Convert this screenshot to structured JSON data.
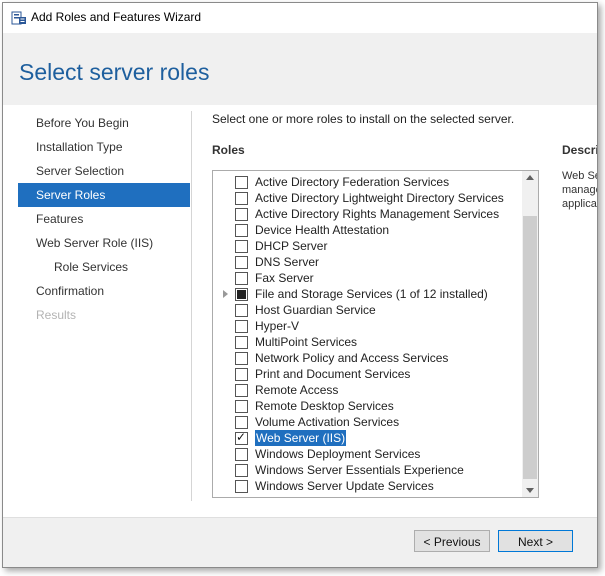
{
  "window": {
    "title": "Add Roles and Features Wizard"
  },
  "header": {
    "title": "Select server roles"
  },
  "nav": {
    "items": [
      {
        "label": "Before You Begin",
        "state": "normal"
      },
      {
        "label": "Installation Type",
        "state": "normal"
      },
      {
        "label": "Server Selection",
        "state": "normal"
      },
      {
        "label": "Server Roles",
        "state": "selected"
      },
      {
        "label": "Features",
        "state": "normal"
      },
      {
        "label": "Web Server Role (IIS)",
        "state": "normal"
      },
      {
        "label": "Role Services",
        "state": "indent"
      },
      {
        "label": "Confirmation",
        "state": "normal"
      },
      {
        "label": "Results",
        "state": "disabled"
      }
    ]
  },
  "main": {
    "instructions": "Select one or more roles to install on the selected server.",
    "roles_label": "Roles",
    "description_label": "Description",
    "description_lines": [
      "Web Server (IIS) provides a reliable,",
      "manageable, and scalable Web",
      "application infrastructure."
    ]
  },
  "roles": [
    {
      "label": "Active Directory Federation Services",
      "checked": "none",
      "expandable": false,
      "selected": false
    },
    {
      "label": "Active Directory Lightweight Directory Services",
      "checked": "none",
      "expandable": false,
      "selected": false
    },
    {
      "label": "Active Directory Rights Management Services",
      "checked": "none",
      "expandable": false,
      "selected": false
    },
    {
      "label": "Device Health Attestation",
      "checked": "none",
      "expandable": false,
      "selected": false
    },
    {
      "label": "DHCP Server",
      "checked": "none",
      "expandable": false,
      "selected": false
    },
    {
      "label": "DNS Server",
      "checked": "none",
      "expandable": false,
      "selected": false
    },
    {
      "label": "Fax Server",
      "checked": "none",
      "expandable": false,
      "selected": false
    },
    {
      "label": "File and Storage Services (1 of 12 installed)",
      "checked": "partial",
      "expandable": true,
      "selected": false
    },
    {
      "label": "Host Guardian Service",
      "checked": "none",
      "expandable": false,
      "selected": false
    },
    {
      "label": "Hyper-V",
      "checked": "none",
      "expandable": false,
      "selected": false
    },
    {
      "label": "MultiPoint Services",
      "checked": "none",
      "expandable": false,
      "selected": false
    },
    {
      "label": "Network Policy and Access Services",
      "checked": "none",
      "expandable": false,
      "selected": false
    },
    {
      "label": "Print and Document Services",
      "checked": "none",
      "expandable": false,
      "selected": false
    },
    {
      "label": "Remote Access",
      "checked": "none",
      "expandable": false,
      "selected": false
    },
    {
      "label": "Remote Desktop Services",
      "checked": "none",
      "expandable": false,
      "selected": false
    },
    {
      "label": "Volume Activation Services",
      "checked": "none",
      "expandable": false,
      "selected": false
    },
    {
      "label": "Web Server (IIS)",
      "checked": "checked",
      "expandable": false,
      "selected": true
    },
    {
      "label": "Windows Deployment Services",
      "checked": "none",
      "expandable": false,
      "selected": false
    },
    {
      "label": "Windows Server Essentials Experience",
      "checked": "none",
      "expandable": false,
      "selected": false
    },
    {
      "label": "Windows Server Update Services",
      "checked": "none",
      "expandable": false,
      "selected": false
    }
  ],
  "footer": {
    "previous_label": "< Previous",
    "next_label": "Next >"
  },
  "colors": {
    "accent": "#1f6fbf",
    "title_blue": "#1e5f9e",
    "panel_gray": "#f0f0f0"
  },
  "icons": {
    "window": "wizard-app-icon",
    "check": "checkmark-icon",
    "expander": "triangle-right-icon"
  }
}
